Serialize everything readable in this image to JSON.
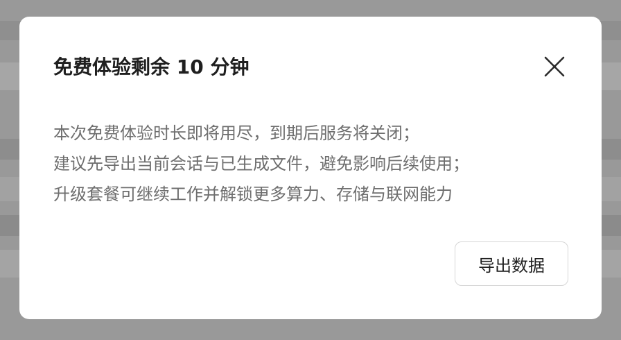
{
  "dialog": {
    "title": "免费体验剩余 10 分钟",
    "close_icon": "close-icon",
    "message_lines": [
      "本次免费体验时长即将用尽，到期后服务将关闭；",
      "建议先导出当前会话与已生成文件，避免影响后续使用；",
      "升级套餐可继续工作并解锁更多算力、存储与联网能力"
    ],
    "export_button_label": "导出数据"
  },
  "colors": {
    "title": "#1f1f1f",
    "body_text": "#6e6e6e",
    "dialog_bg": "#ffffff",
    "overlay": "#999999",
    "button_border": "#d6d6d6"
  }
}
